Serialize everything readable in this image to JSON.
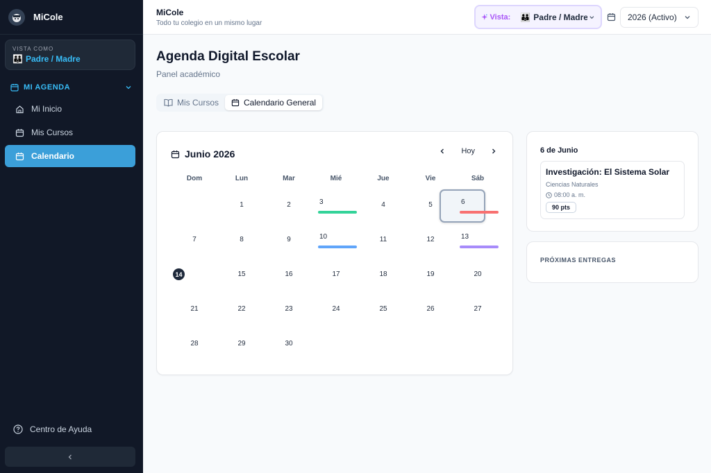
{
  "brand": {
    "name": "MiCole"
  },
  "sidebar": {
    "view_as_label": "VISTA COMO",
    "view_as_icon": "👪",
    "view_as_value": "Padre / Madre",
    "section_label": "MI AGENDA",
    "items": [
      {
        "label": "Mi Inicio",
        "icon": "home-icon"
      },
      {
        "label": "Mis Cursos",
        "icon": "calendar-icon"
      },
      {
        "label": "Calendario",
        "icon": "calendar-icon",
        "active": true
      }
    ],
    "help_label": "Centro de Ayuda",
    "accent_color": "#38bdf8",
    "active_color": "#3b9fd9"
  },
  "topbar": {
    "title": "MiCole",
    "subtitle": "Todo tu colegio en un mismo lugar",
    "role_label": "Vista:",
    "role_icon": "👪",
    "role_value": "Padre / Madre",
    "year_value": "2026 (Activo)"
  },
  "main": {
    "title": "Agenda Digital Escolar",
    "subtitle": "Panel académico",
    "tabs": [
      {
        "label": "Mis Cursos",
        "icon": "book-icon"
      },
      {
        "label": "Calendario General",
        "icon": "calendar-icon",
        "active": true
      }
    ]
  },
  "calendar": {
    "month_label": "Junio 2026",
    "today_label": "Hoy",
    "weekdays": [
      "Dom",
      "Lun",
      "Mar",
      "Mié",
      "Jue",
      "Vie",
      "Sáb"
    ],
    "first_weekday_index": 1,
    "days_in_month": 30,
    "today": 14,
    "selected": 6,
    "events": [
      {
        "day": 3,
        "color": "#34d399"
      },
      {
        "day": 6,
        "color": "#f87171"
      },
      {
        "day": 10,
        "color": "#60a5fa"
      },
      {
        "day": 13,
        "color": "#a78bfa"
      }
    ]
  },
  "detail": {
    "date_label": "6 de Junio",
    "task": {
      "title": "Investigación: El Sistema Solar",
      "subject": "Ciencias Naturales",
      "time": "08:00 a. m.",
      "points": "90 pts"
    }
  },
  "upcoming": {
    "label": "PRÓXIMAS ENTREGAS"
  }
}
